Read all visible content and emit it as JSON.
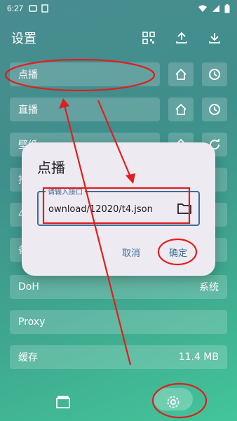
{
  "status": {
    "time": "6:27"
  },
  "header": {
    "title": "设置"
  },
  "rows": [
    {
      "label": "点播",
      "value": ""
    },
    {
      "label": "直播",
      "value": ""
    },
    {
      "label": "壁纸",
      "value": ""
    },
    {
      "label": "推",
      "value": ""
    },
    {
      "label": "4",
      "value": ""
    },
    {
      "label": "备",
      "value": ""
    },
    {
      "label": "DoH",
      "value": "系统"
    },
    {
      "label": "Proxy",
      "value": ""
    },
    {
      "label": "缓存",
      "value": "11.4 MB"
    }
  ],
  "dialog": {
    "title": "点播",
    "field_label": "请输入接口",
    "field_value": "ownload/12020/t4.json",
    "cancel": "取消",
    "confirm": "确定"
  },
  "icons": {
    "qr": "qr-code-icon",
    "upload": "upload-icon",
    "download": "download-icon",
    "home": "home-icon",
    "history": "history-icon",
    "refresh": "refresh-icon",
    "folder": "folder-icon",
    "movie": "movie-icon",
    "settings": "settings-gear-icon"
  },
  "annotation_color": "#e01e1e"
}
